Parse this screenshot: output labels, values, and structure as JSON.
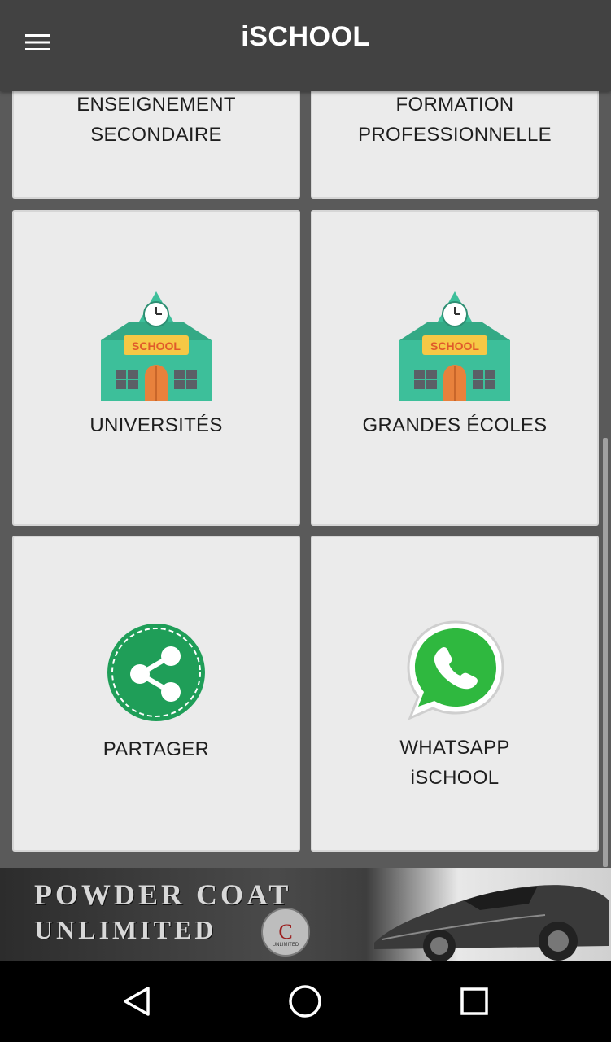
{
  "appbar": {
    "title": "iSCHOOL",
    "menu_icon": "hamburger-menu-icon"
  },
  "cards": [
    {
      "label": "ENSEIGNEMENT\nSECONDAIRE",
      "icon": null
    },
    {
      "label": "FORMATION\nPROFESSIONNELLE",
      "icon": null
    },
    {
      "label": "UNIVERSITÉS",
      "icon": "school-building-icon",
      "icon_text": "SCHOOL"
    },
    {
      "label": "GRANDES ÉCOLES",
      "icon": "school-building-icon",
      "icon_text": "SCHOOL"
    },
    {
      "label": "PARTAGER",
      "icon": "share-icon"
    },
    {
      "label": "WHATSAPP\niSCHOOL",
      "icon": "whatsapp-icon"
    }
  ],
  "ad": {
    "line1": "POWDER COAT",
    "line2": "UNLIMITED",
    "logo_text": "UNLIMITED"
  },
  "navbar": {
    "back_icon": "back-triangle-icon",
    "home_icon": "home-circle-icon",
    "recents_icon": "recents-square-icon"
  },
  "colors": {
    "appbar": "#424242",
    "background": "#5a5a5a",
    "card": "#ebebeb",
    "school_green": "#3dbf9a",
    "share_green": "#1f9e58",
    "whatsapp_green": "#2fb83f"
  }
}
